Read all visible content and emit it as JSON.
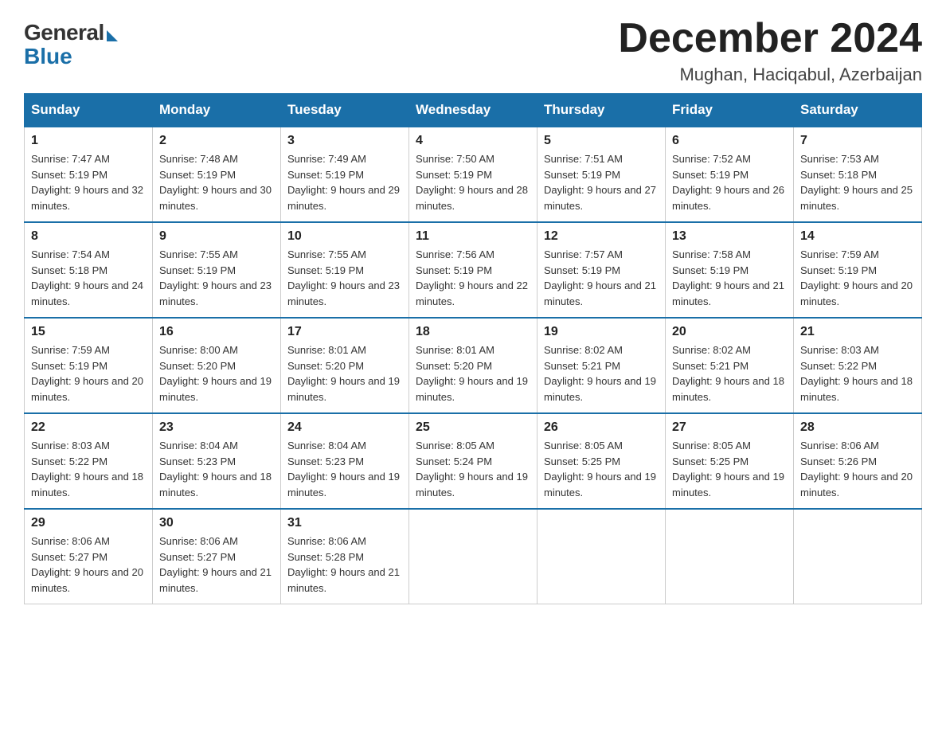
{
  "logo": {
    "general": "General",
    "blue": "Blue"
  },
  "title": "December 2024",
  "location": "Mughan, Haciqabul, Azerbaijan",
  "days_of_week": [
    "Sunday",
    "Monday",
    "Tuesday",
    "Wednesday",
    "Thursday",
    "Friday",
    "Saturday"
  ],
  "weeks": [
    [
      {
        "day": "1",
        "sunrise": "7:47 AM",
        "sunset": "5:19 PM",
        "daylight": "9 hours and 32 minutes."
      },
      {
        "day": "2",
        "sunrise": "7:48 AM",
        "sunset": "5:19 PM",
        "daylight": "9 hours and 30 minutes."
      },
      {
        "day": "3",
        "sunrise": "7:49 AM",
        "sunset": "5:19 PM",
        "daylight": "9 hours and 29 minutes."
      },
      {
        "day": "4",
        "sunrise": "7:50 AM",
        "sunset": "5:19 PM",
        "daylight": "9 hours and 28 minutes."
      },
      {
        "day": "5",
        "sunrise": "7:51 AM",
        "sunset": "5:19 PM",
        "daylight": "9 hours and 27 minutes."
      },
      {
        "day": "6",
        "sunrise": "7:52 AM",
        "sunset": "5:19 PM",
        "daylight": "9 hours and 26 minutes."
      },
      {
        "day": "7",
        "sunrise": "7:53 AM",
        "sunset": "5:18 PM",
        "daylight": "9 hours and 25 minutes."
      }
    ],
    [
      {
        "day": "8",
        "sunrise": "7:54 AM",
        "sunset": "5:18 PM",
        "daylight": "9 hours and 24 minutes."
      },
      {
        "day": "9",
        "sunrise": "7:55 AM",
        "sunset": "5:19 PM",
        "daylight": "9 hours and 23 minutes."
      },
      {
        "day": "10",
        "sunrise": "7:55 AM",
        "sunset": "5:19 PM",
        "daylight": "9 hours and 23 minutes."
      },
      {
        "day": "11",
        "sunrise": "7:56 AM",
        "sunset": "5:19 PM",
        "daylight": "9 hours and 22 minutes."
      },
      {
        "day": "12",
        "sunrise": "7:57 AM",
        "sunset": "5:19 PM",
        "daylight": "9 hours and 21 minutes."
      },
      {
        "day": "13",
        "sunrise": "7:58 AM",
        "sunset": "5:19 PM",
        "daylight": "9 hours and 21 minutes."
      },
      {
        "day": "14",
        "sunrise": "7:59 AM",
        "sunset": "5:19 PM",
        "daylight": "9 hours and 20 minutes."
      }
    ],
    [
      {
        "day": "15",
        "sunrise": "7:59 AM",
        "sunset": "5:19 PM",
        "daylight": "9 hours and 20 minutes."
      },
      {
        "day": "16",
        "sunrise": "8:00 AM",
        "sunset": "5:20 PM",
        "daylight": "9 hours and 19 minutes."
      },
      {
        "day": "17",
        "sunrise": "8:01 AM",
        "sunset": "5:20 PM",
        "daylight": "9 hours and 19 minutes."
      },
      {
        "day": "18",
        "sunrise": "8:01 AM",
        "sunset": "5:20 PM",
        "daylight": "9 hours and 19 minutes."
      },
      {
        "day": "19",
        "sunrise": "8:02 AM",
        "sunset": "5:21 PM",
        "daylight": "9 hours and 19 minutes."
      },
      {
        "day": "20",
        "sunrise": "8:02 AM",
        "sunset": "5:21 PM",
        "daylight": "9 hours and 18 minutes."
      },
      {
        "day": "21",
        "sunrise": "8:03 AM",
        "sunset": "5:22 PM",
        "daylight": "9 hours and 18 minutes."
      }
    ],
    [
      {
        "day": "22",
        "sunrise": "8:03 AM",
        "sunset": "5:22 PM",
        "daylight": "9 hours and 18 minutes."
      },
      {
        "day": "23",
        "sunrise": "8:04 AM",
        "sunset": "5:23 PM",
        "daylight": "9 hours and 18 minutes."
      },
      {
        "day": "24",
        "sunrise": "8:04 AM",
        "sunset": "5:23 PM",
        "daylight": "9 hours and 19 minutes."
      },
      {
        "day": "25",
        "sunrise": "8:05 AM",
        "sunset": "5:24 PM",
        "daylight": "9 hours and 19 minutes."
      },
      {
        "day": "26",
        "sunrise": "8:05 AM",
        "sunset": "5:25 PM",
        "daylight": "9 hours and 19 minutes."
      },
      {
        "day": "27",
        "sunrise": "8:05 AM",
        "sunset": "5:25 PM",
        "daylight": "9 hours and 19 minutes."
      },
      {
        "day": "28",
        "sunrise": "8:06 AM",
        "sunset": "5:26 PM",
        "daylight": "9 hours and 20 minutes."
      }
    ],
    [
      {
        "day": "29",
        "sunrise": "8:06 AM",
        "sunset": "5:27 PM",
        "daylight": "9 hours and 20 minutes."
      },
      {
        "day": "30",
        "sunrise": "8:06 AM",
        "sunset": "5:27 PM",
        "daylight": "9 hours and 21 minutes."
      },
      {
        "day": "31",
        "sunrise": "8:06 AM",
        "sunset": "5:28 PM",
        "daylight": "9 hours and 21 minutes."
      },
      null,
      null,
      null,
      null
    ]
  ]
}
